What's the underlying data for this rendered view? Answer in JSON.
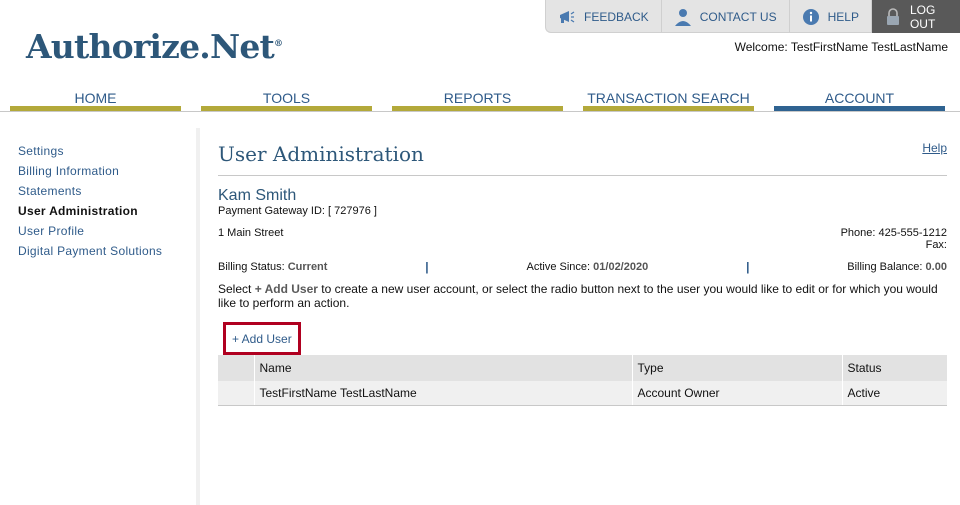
{
  "utility": {
    "feedback": "FEEDBACK",
    "contact": "CONTACT US",
    "help": "HELP",
    "logout": "LOG OUT"
  },
  "brand": {
    "name": "Authorize.Net",
    "mark": "®"
  },
  "welcome": "Welcome: TestFirstName TestLastName",
  "nav": [
    {
      "label": "HOME"
    },
    {
      "label": "TOOLS"
    },
    {
      "label": "REPORTS"
    },
    {
      "label": "TRANSACTION SEARCH"
    },
    {
      "label": "ACCOUNT"
    }
  ],
  "sidebar": [
    {
      "label": "Settings"
    },
    {
      "label": "Billing Information"
    },
    {
      "label": "Statements"
    },
    {
      "label": "User Administration"
    },
    {
      "label": "User Profile"
    },
    {
      "label": "Digital Payment Solutions"
    }
  ],
  "page": {
    "title": "User Administration",
    "help": "Help",
    "account_name": "Kam Smith",
    "gateway_id": "Payment Gateway ID: [ 727976 ]",
    "address": "1 Main Street",
    "phone": "Phone: 425-555-1212",
    "fax": "Fax:",
    "billing_status_label": "Billing Status:",
    "billing_status_value": "Current",
    "separator": "|",
    "active_since_label": "Active Since:",
    "active_since_value": "01/02/2020",
    "billing_balance_label": "Billing Balance:",
    "billing_balance_value": "0.00",
    "instructions_pre": "Select ",
    "instructions_action": "+ Add User",
    "instructions_post": " to create a new user account, or select the radio button next to the user you would like to edit or for which you would like to perform an action.",
    "add_user": "+ Add User"
  },
  "table": {
    "headers": [
      "Name",
      "Type",
      "Status"
    ],
    "rows": [
      {
        "name": "TestFirstName TestLastName",
        "type": "Account Owner",
        "status": "Active"
      }
    ]
  },
  "colors": {
    "brand_blue": "#2d5779",
    "nav_olive": "#b3a93a",
    "nav_active": "#2f6391",
    "highlight_red": "#b00020"
  }
}
